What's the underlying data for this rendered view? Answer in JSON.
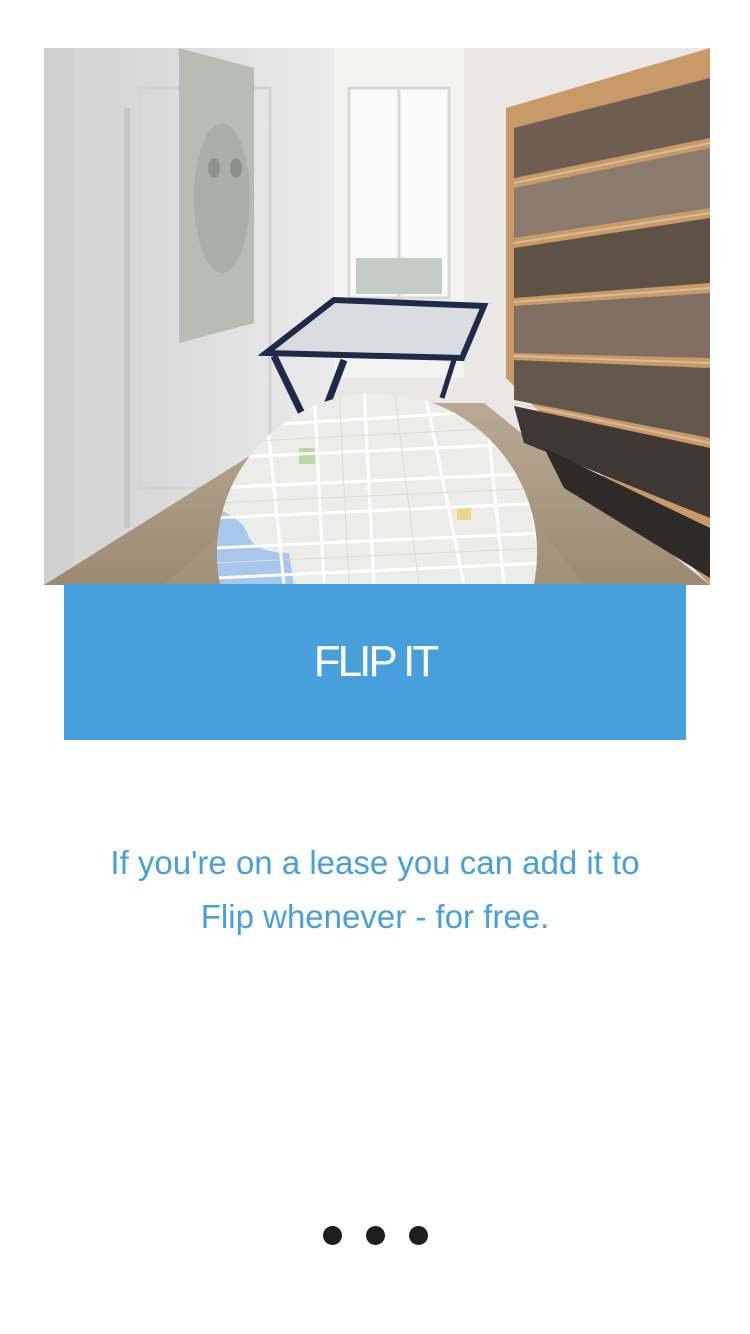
{
  "hero": {
    "image": "hallway-bookshelf-photo",
    "overlay": "city-map-circle"
  },
  "cta": {
    "label": "FLIP IT",
    "color": "#479fdc"
  },
  "description": {
    "line1": "If you're on a lease you can add it to",
    "line2": "Flip whenever - for free."
  },
  "pager": {
    "pages": 3,
    "dot_color": "#1e1e1e"
  }
}
